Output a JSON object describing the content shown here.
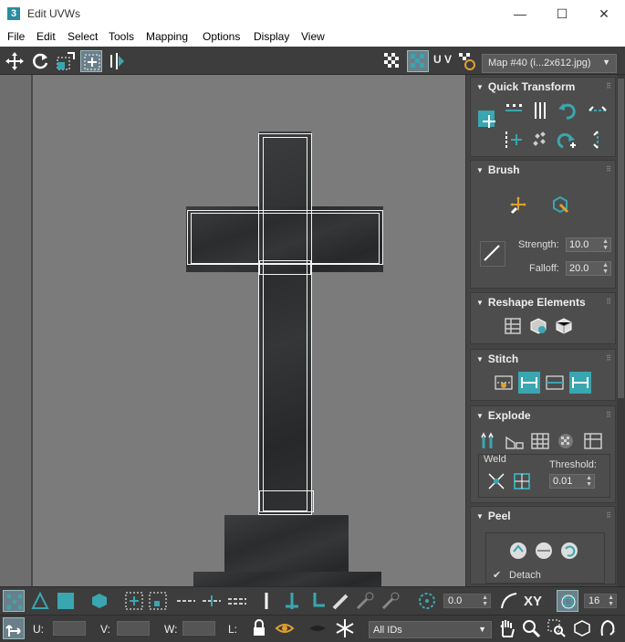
{
  "window": {
    "app_icon_text": "3",
    "title": "Edit UVWs",
    "minimize": "—",
    "maximize": "☐",
    "close": "✕"
  },
  "menu": [
    "File",
    "Edit",
    "Select",
    "Tools",
    "Mapping",
    "Options",
    "Display",
    "View"
  ],
  "toolbar": {
    "uv_label": "U V",
    "map_select": "Map #40 (i...2x612.jpg)"
  },
  "rollouts": {
    "quick_transform": {
      "title": "Quick Transform"
    },
    "brush": {
      "title": "Brush",
      "strength_label": "Strength:",
      "strength_value": "10.0",
      "falloff_label": "Falloff:",
      "falloff_value": "20.0"
    },
    "reshape": {
      "title": "Reshape Elements"
    },
    "stitch": {
      "title": "Stitch"
    },
    "explode": {
      "title": "Explode",
      "weld_label": "Weld",
      "threshold_label": "Threshold:",
      "threshold_value": "0.01"
    },
    "peel": {
      "title": "Peel",
      "detach_check": "✔",
      "detach_label": "Detach"
    }
  },
  "bottom_bar": {
    "rotation_value": "0.0",
    "xy_label": "XY",
    "grid_value": "16",
    "u_label": "U:",
    "v_label": "V:",
    "w_label": "W:",
    "l_label": "L:",
    "u_value": "",
    "v_value": "",
    "w_value": "",
    "ids_select": "All IDs"
  },
  "colors": {
    "accent": "#3aa6b0",
    "panel_bg": "#444444",
    "viewport_bg": "#7b7b7b",
    "uv_edges": "#f4f4f4"
  }
}
